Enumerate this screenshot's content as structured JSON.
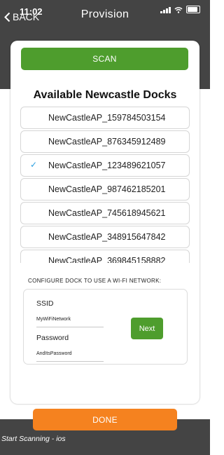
{
  "status_bar": {
    "time": "11:02"
  },
  "nav": {
    "back_label": "BACK",
    "title": "Provision"
  },
  "scan_button": {
    "label": "SCAN"
  },
  "dock_list": {
    "title": "Available Newcastle Docks",
    "items": [
      {
        "label": "NewCastleAP_159784503154",
        "selected": false
      },
      {
        "label": "NewCastleAP_876345912489",
        "selected": false
      },
      {
        "label": "NewCastleAP_123489621057",
        "selected": true
      },
      {
        "label": "NewCastleAP_987462185201",
        "selected": false
      },
      {
        "label": "NewCastleAP_745618945621",
        "selected": false
      },
      {
        "label": "NewCastleAP_348915647842",
        "selected": false
      },
      {
        "label": "NewCastleAP_369845158882",
        "selected": false
      }
    ],
    "selected_mark": "✓"
  },
  "wifi_config": {
    "heading": "CONFIGURE DOCK TO USE A WI-FI NETWORK:",
    "ssid_label": "SSID",
    "ssid_value": "MyWiFiNetwork",
    "password_label": "Password",
    "password_value": "AndItsPassword",
    "next_label": "Next"
  },
  "done_button": {
    "label": "DONE"
  },
  "footer": {
    "status": "Start Scanning - ios"
  },
  "colors": {
    "header_bg": "#444444",
    "scan_green": "#4e9d2d",
    "done_orange": "#f5821f",
    "check_blue": "#2b9fe0"
  }
}
